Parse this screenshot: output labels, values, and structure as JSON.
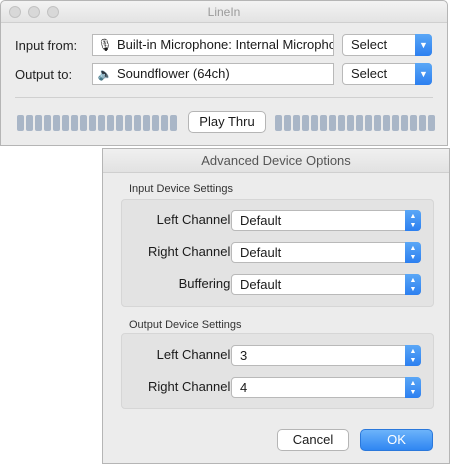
{
  "main_window": {
    "title": "LineIn",
    "input_label": "Input from:",
    "input_device": "Built-in Microphone: Internal Microphone",
    "input_select": "Select",
    "output_label": "Output to:",
    "output_device": "Soundflower (64ch)",
    "output_select": "Select",
    "play_thru": "Play Thru",
    "icons": {
      "input": "microphone-icon",
      "output": "speaker-icon"
    }
  },
  "advanced": {
    "title": "Advanced Device Options",
    "input_group": {
      "title": "Input Device Settings",
      "left_label": "Left Channel:",
      "left_value": "Default",
      "right_label": "Right Channel:",
      "right_value": "Default",
      "buffering_label": "Buffering:",
      "buffering_value": "Default"
    },
    "output_group": {
      "title": "Output Device Settings",
      "left_label": "Left Channel:",
      "left_value": "3",
      "right_label": "Right Channel:",
      "right_value": "4"
    },
    "cancel": "Cancel",
    "ok": "OK"
  },
  "colors": {
    "accent": "#2f86f2",
    "meter": "#a9b6c7"
  }
}
